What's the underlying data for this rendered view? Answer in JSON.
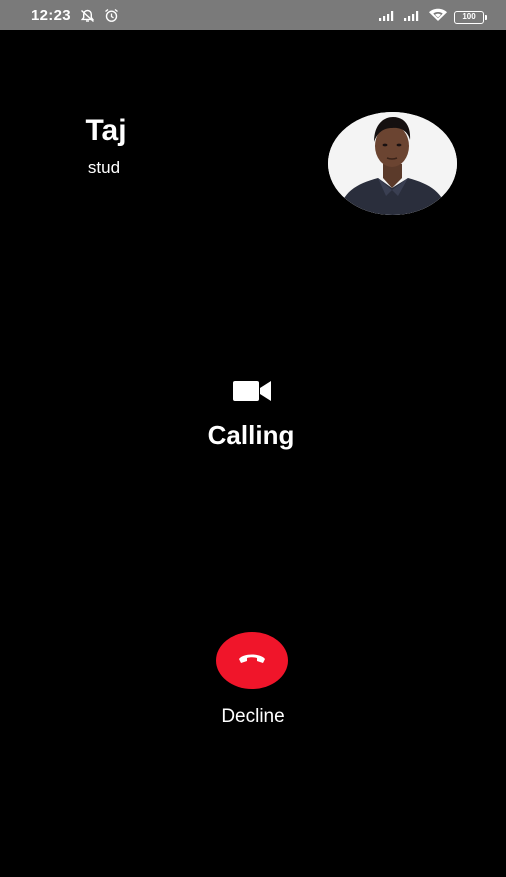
{
  "status_bar": {
    "time": "12:23",
    "battery": "100"
  },
  "caller": {
    "name": "Taj",
    "subtitle": "stud"
  },
  "call": {
    "status": "Calling",
    "decline_label": "Decline"
  },
  "colors": {
    "background": "#000000",
    "status_bar": "#7a7a7a",
    "decline": "#f0152a"
  },
  "icons": [
    "mute-notification-icon",
    "alarm-icon",
    "signal-icon",
    "wifi-icon",
    "battery-icon",
    "video-camera-icon",
    "phone-hangup-icon"
  ]
}
